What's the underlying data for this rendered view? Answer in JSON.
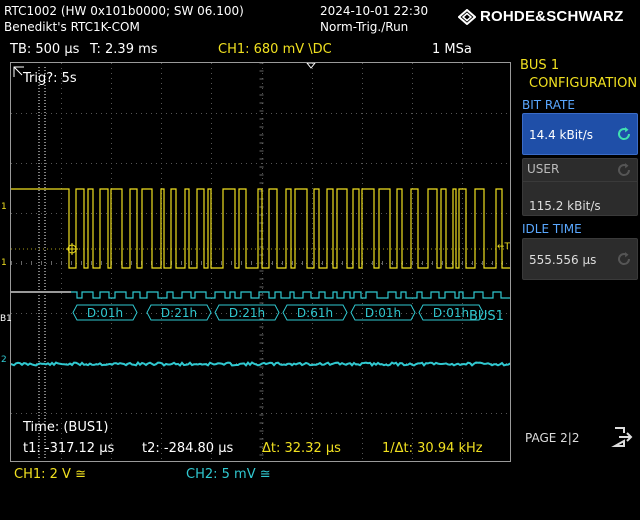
{
  "header": {
    "device": "RTC1002 (HW 0x101b0000; SW 06.100)",
    "owner": "Benedikt's RTC1K-COM",
    "datetime": "2024-10-01 22:30",
    "trigger_mode": "Norm-Trig./Run",
    "brand": "ROHDE&SCHWARZ"
  },
  "status": {
    "timebase": "TB: 500 µs",
    "trigger_time": "T: 2.39 ms",
    "ch1": "CH1: 680 mV \\DC",
    "sample_rate": "1 MSa"
  },
  "screen": {
    "trig_timeout": "Trig?: 5s",
    "bus_label": "BUS1",
    "decode_frames": [
      "D:01h",
      "D:21h",
      "D:21h",
      "D:61h",
      "D:01h",
      "D:01h"
    ],
    "marker_left_1": "1",
    "marker_left_b1": "B1",
    "marker_left_2": "2",
    "marker_right_t": "←T",
    "cursor": {
      "source": "Time: (BUS1)",
      "t1": "t1: -317.12 µs",
      "t2": "t2: -284.80 µs",
      "dt": "Δt: 32.32 µs",
      "inv_dt": "1/Δt: 30.94 kHz"
    }
  },
  "panel": {
    "title1": "BUS 1",
    "title2": "CONFIGURATION",
    "bitrate_label": "BIT RATE",
    "bitrate_value": "14.4 kBit/s",
    "user_label": "USER",
    "user_value": "115.2 kBit/s",
    "idle_label": "IDLE TIME",
    "idle_value": "555.556 µs",
    "page": "PAGE 2|2"
  },
  "footer": {
    "ch1": "CH1: 2 V ≅",
    "ch2": "CH2: 5 mV ≅"
  },
  "colors": {
    "ch1": "#f0e020",
    "ch2": "#30c8d0",
    "bus": "#30c8d0",
    "selected": "#1f4fa8",
    "label_blue": "#5aa8ff"
  },
  "icons": {
    "refresh": "refresh-icon",
    "exit": "exit-icon",
    "logo": "rohde-schwarz-logo-icon"
  }
}
